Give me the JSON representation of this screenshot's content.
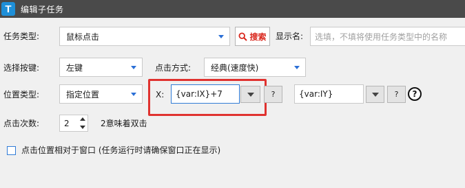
{
  "window": {
    "title": "编辑子任务",
    "app_icon_letter": "T",
    "title_bar_color": "#4a4a4a",
    "accent_color": "#1e8fd8"
  },
  "task_type": {
    "label": "任务类型:",
    "value": "鼠标点击",
    "search_label": "搜索",
    "search_icon": "magnifier-icon"
  },
  "display_name": {
    "label": "显示名:",
    "placeholder": "选填，不填将使用任务类型中的名称"
  },
  "button_select": {
    "label": "选择按键:",
    "value": "左键"
  },
  "click_method": {
    "label": "点击方式:",
    "value": "经典(速度快)"
  },
  "position_type": {
    "label": "位置类型:",
    "value": "指定位置"
  },
  "x_field": {
    "label": "X:",
    "value": "{var:IX}+7",
    "help": "?",
    "highlight_color": "#e0322f"
  },
  "y_field": {
    "value": "{var:IY}",
    "help": "?",
    "info_help": "?"
  },
  "click_count": {
    "label": "点击次数:",
    "value": "2",
    "hint": "2意味着双击"
  },
  "relative_window": {
    "label": "点击位置相对于窗口 (任务运行时请确保窗口正在显示)",
    "checked": false
  }
}
